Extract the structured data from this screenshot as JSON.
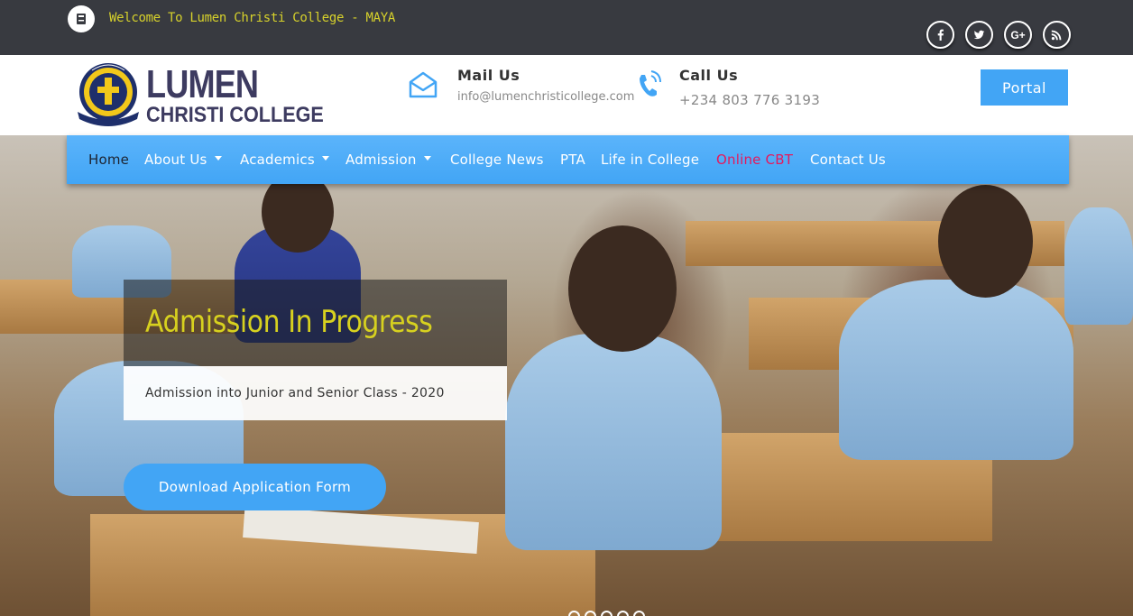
{
  "topbar": {
    "welcome": "Welcome To Lumen Christi College - MAYA",
    "social": [
      {
        "icon": "facebook-icon"
      },
      {
        "icon": "twitter-icon"
      },
      {
        "icon": "google-plus-icon",
        "label": "G+"
      },
      {
        "icon": "rss-icon"
      }
    ]
  },
  "header": {
    "logo_line1": "LUMEN",
    "logo_line2": "CHRISTI COLLEGE",
    "crest_text": "LUMEN CHRISTI",
    "crest_motto": "IN CRUCE SALUS",
    "mail_title": "Mail Us",
    "mail_value": "info@lumenchristicollege.com",
    "call_title": "Call Us",
    "call_value": "+234 803 776 3193",
    "portal_label": "Portal"
  },
  "nav": {
    "items": [
      {
        "label": "Home"
      },
      {
        "label": "About Us"
      },
      {
        "label": "Academics"
      },
      {
        "label": "Admission"
      },
      {
        "label": "College News"
      },
      {
        "label": "PTA"
      },
      {
        "label": "Life in College"
      },
      {
        "label": "Online CBT"
      },
      {
        "label": "Contact Us"
      }
    ]
  },
  "slide": {
    "title": "Admission In Progress",
    "subtitle": "Admission into Junior and Senior Class - 2020",
    "button": "Download Application Form"
  },
  "colors": {
    "topbar_bg": "#383a40",
    "welcome_text": "#d6d12b",
    "accent": "#42a5f5",
    "brand_text": "#3d3b60",
    "cbt": "#e5195d",
    "slide_title": "#d7d11f"
  }
}
